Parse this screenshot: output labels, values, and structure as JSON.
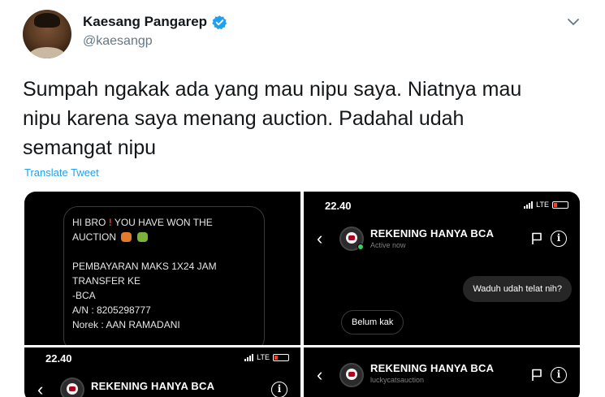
{
  "tweet": {
    "author_name": "Kaesang Pangarep",
    "author_handle": "@kaesangp",
    "text": "Sumpah ngakak ada yang mau nipu saya. Niatnya mau\nnipu karena saya menang auction. Padahal udah\nsemangat nipu",
    "translate_label": "Translate Tweet"
  },
  "media": {
    "image1": {
      "message_lines": [
        "HI BRO",
        "YOU HAVE WON THE",
        "AUCTION",
        "",
        "PEMBAYARAN MAKS 1X24 JAM",
        "TRANSFER KE",
        "-BCA",
        "A/N : 8205298777",
        "Norek : AAN RAMADANI"
      ]
    },
    "image2": {
      "time": "22.40",
      "network": "LTE",
      "contact": "REKENING HANYA BCA",
      "status": "Active now",
      "sent_message": "Waduh udah telat nih?",
      "received_message": "Belum kak"
    },
    "image3": {
      "time": "22.40",
      "network": "LTE",
      "contact": "REKENING HANYA BCA"
    },
    "image4": {
      "contact": "REKENING HANYA BCA",
      "username": "luckycatsauction"
    }
  },
  "colors": {
    "link": "#1da1f2",
    "verified": "#1da1f2",
    "handle": "#657786"
  }
}
